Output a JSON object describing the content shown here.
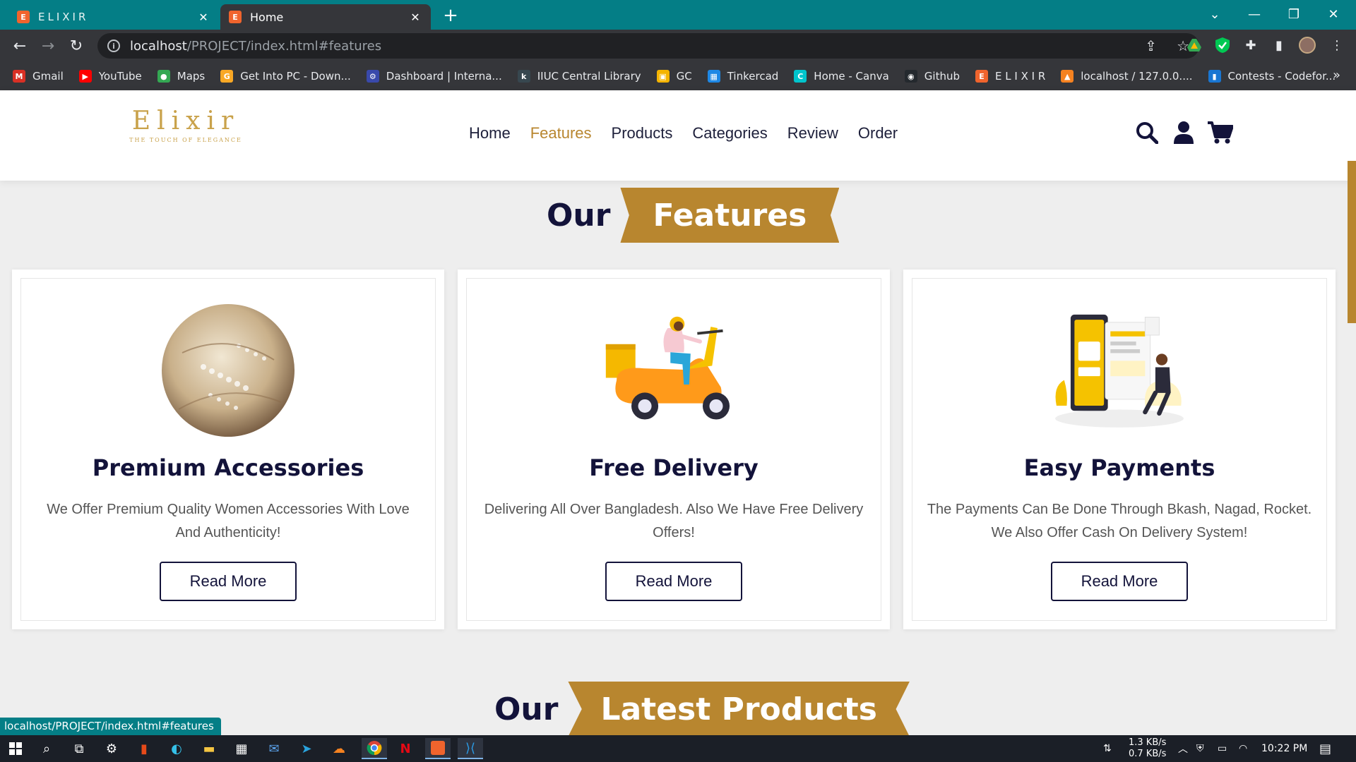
{
  "browser": {
    "tabs": [
      {
        "title": "ELIXIR",
        "favicon": "E"
      },
      {
        "title": "Home",
        "favicon": "E"
      }
    ],
    "url": {
      "host": "localhost",
      "path": "/PROJECT/index.html#features"
    },
    "bookmarks": [
      {
        "label": "Gmail",
        "icon": "gmail-icon",
        "color": "#d93025",
        "glyph": "M"
      },
      {
        "label": "YouTube",
        "icon": "youtube-icon",
        "color": "#ff0000",
        "glyph": "▶"
      },
      {
        "label": "Maps",
        "icon": "maps-icon",
        "color": "#34a853",
        "glyph": "●"
      },
      {
        "label": "Get Into PC - Down...",
        "icon": "getintopc-icon",
        "color": "#f9a825",
        "glyph": "G"
      },
      {
        "label": "Dashboard | Interna...",
        "icon": "dashboard-icon",
        "color": "#3949ab",
        "glyph": "⚙"
      },
      {
        "label": "IIUC Central Library",
        "icon": "library-icon",
        "color": "#37474f",
        "glyph": "k"
      },
      {
        "label": "GC",
        "icon": "classroom-icon",
        "color": "#f4b400",
        "glyph": "▣"
      },
      {
        "label": "Tinkercad",
        "icon": "tinkercad-icon",
        "color": "#1e88e5",
        "glyph": "▦"
      },
      {
        "label": "Home - Canva",
        "icon": "canva-icon",
        "color": "#00c4cc",
        "glyph": "C"
      },
      {
        "label": "Github",
        "icon": "github-icon",
        "color": "#24292e",
        "glyph": "◉"
      },
      {
        "label": "E L I X I R",
        "icon": "elixir-icon",
        "color": "#f0642d",
        "glyph": "E"
      },
      {
        "label": "localhost / 127.0.0....",
        "icon": "phpmyadmin-icon",
        "color": "#f58220",
        "glyph": "▲"
      },
      {
        "label": "Contests - Codefor...",
        "icon": "codeforces-icon",
        "color": "#1976d2",
        "glyph": "▮"
      }
    ],
    "status_url": "localhost/PROJECT/index.html#features"
  },
  "site": {
    "logo": {
      "name": "Elixir",
      "tagline": "THE TOUCH OF ELEGANCE"
    },
    "nav": [
      "Home",
      "Features",
      "Products",
      "Categories",
      "Review",
      "Order"
    ],
    "active_nav": "Features",
    "accent": "#b8862f",
    "navy": "#13133a"
  },
  "features_section": {
    "prefix": "Our",
    "highlight": "Features",
    "cards": [
      {
        "title": "Premium Accessories",
        "text": "We Offer Premium Quality Women Accessories With Love And Authenticity!",
        "button": "Read More",
        "image": "accessories-photo"
      },
      {
        "title": "Free Delivery",
        "text": "Delivering All Over Bangladesh. Also We Have Free Delivery Offers!",
        "button": "Read More",
        "image": "delivery-scooter-illustration"
      },
      {
        "title": "Easy Payments",
        "text": "The Payments Can Be Done Through Bkash, Nagad, Rocket. We Also Offer Cash On Delivery System!",
        "button": "Read More",
        "image": "mobile-payment-illustration"
      }
    ]
  },
  "products_section": {
    "prefix": "Our",
    "highlight": "Latest Products"
  },
  "taskbar": {
    "net_down": "1.3 KB/s",
    "net_up": "0.7 KB/s",
    "time": "10:22 PM"
  }
}
